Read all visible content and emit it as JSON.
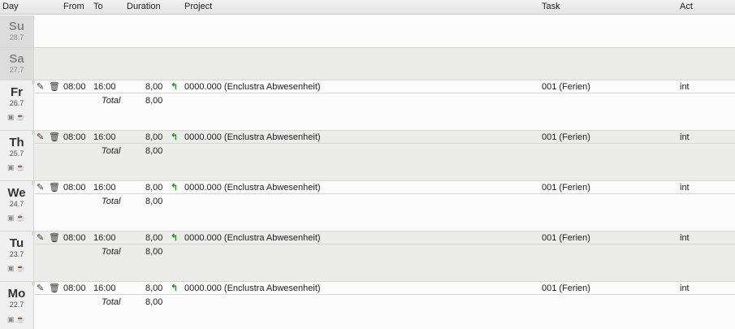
{
  "columns": {
    "day": "Day",
    "from": "From",
    "to": "To",
    "duration": "Duration",
    "project": "Project",
    "task": "Task",
    "act": "Act"
  },
  "icons": {
    "edit": "pencil-icon",
    "delete": "trash-icon",
    "jump": "arrow-icon",
    "copy": "copy-icon",
    "coffee": "coffee-icon"
  },
  "total_label": "Total",
  "days": [
    {
      "name": "Su",
      "date": "28.7",
      "weekend": true,
      "entries": []
    },
    {
      "name": "Sa",
      "date": "27.7",
      "weekend": true,
      "entries": []
    },
    {
      "name": "Fr",
      "date": "26.7",
      "weekend": false,
      "from": "08:00",
      "to": "16:00",
      "duration": "8,00",
      "project": "0000.000 (Enclustra Abwesenheit)",
      "task": "001 (Ferien)",
      "act": "int",
      "total": "8,00"
    },
    {
      "name": "Th",
      "date": "25.7",
      "weekend": false,
      "from": "08:00",
      "to": "16:00",
      "duration": "8,00",
      "project": "0000.000 (Enclustra Abwesenheit)",
      "task": "001 (Ferien)",
      "act": "int",
      "total": "8,00"
    },
    {
      "name": "We",
      "date": "24.7",
      "weekend": false,
      "from": "08:00",
      "to": "16:00",
      "duration": "8,00",
      "project": "0000.000 (Enclustra Abwesenheit)",
      "task": "001 (Ferien)",
      "act": "int",
      "total": "8,00"
    },
    {
      "name": "Tu",
      "date": "23.7",
      "weekend": false,
      "from": "08:00",
      "to": "16:00",
      "duration": "8,00",
      "project": "0000.000 (Enclustra Abwesenheit)",
      "task": "001 (Ferien)",
      "act": "int",
      "total": "8,00"
    },
    {
      "name": "Mo",
      "date": "22.7",
      "weekend": false,
      "from": "08:00",
      "to": "16:00",
      "duration": "8,00",
      "project": "0000.000 (Enclustra Abwesenheit)",
      "task": "001 (Ferien)",
      "act": "int",
      "total": "8,00"
    }
  ]
}
